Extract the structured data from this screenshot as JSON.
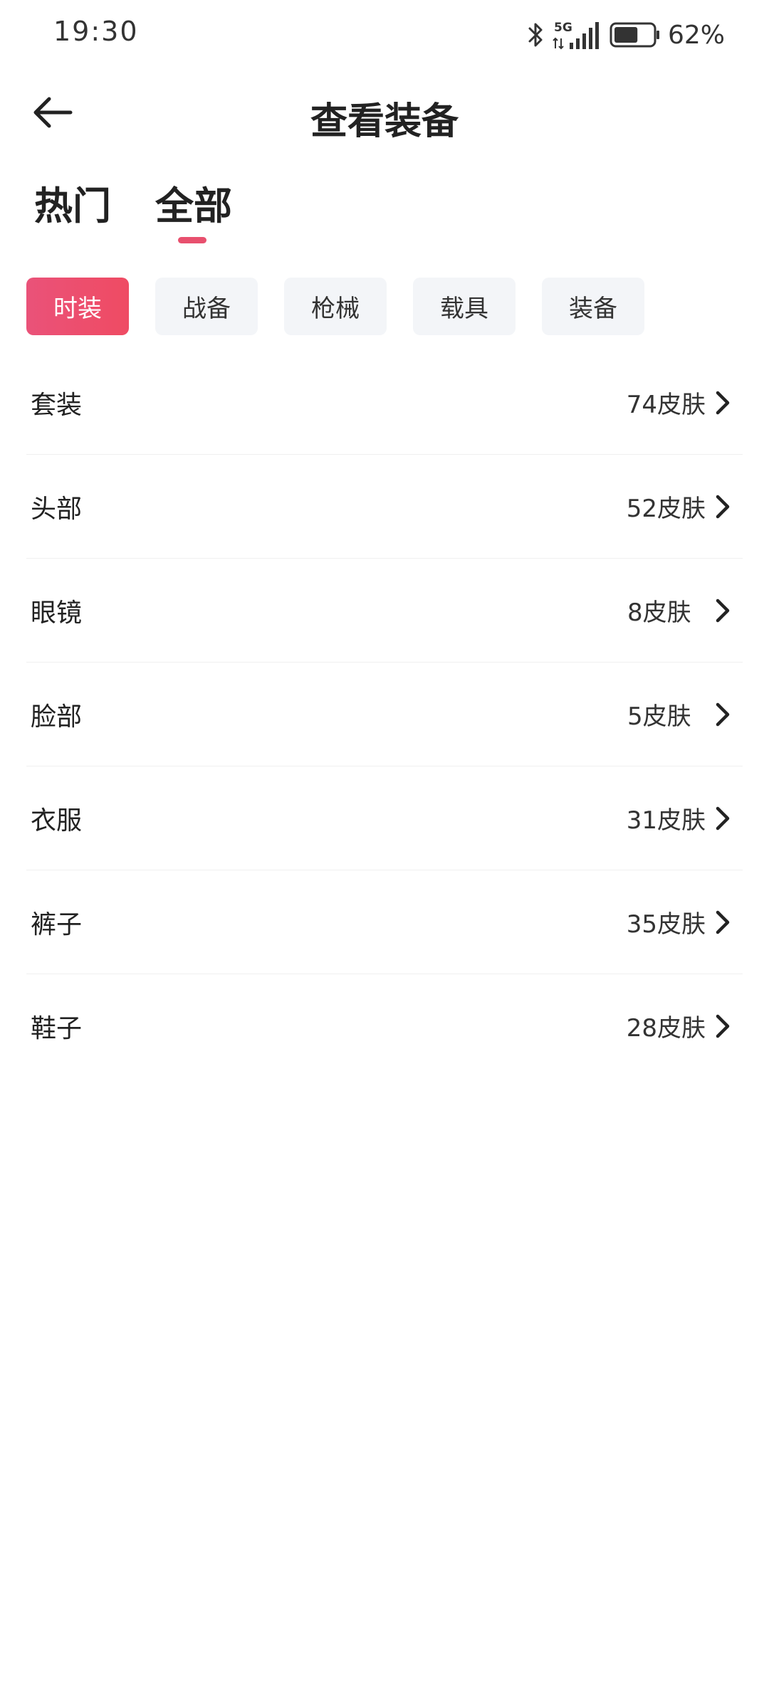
{
  "status_bar": {
    "time": "19:30",
    "network": "5G",
    "battery_percent": "62%",
    "battery_level": 0.62,
    "icons": [
      "bluetooth-icon",
      "signal-icon",
      "battery-icon"
    ]
  },
  "header": {
    "title": "查看装备",
    "back_icon": "arrow-left-icon"
  },
  "main_tabs": [
    {
      "label": "热门",
      "selected": false
    },
    {
      "label": "全部",
      "selected": true
    }
  ],
  "categories": [
    {
      "label": "时装",
      "selected": true
    },
    {
      "label": "战备",
      "selected": false
    },
    {
      "label": "枪械",
      "selected": false
    },
    {
      "label": "载具",
      "selected": false
    },
    {
      "label": "装备",
      "selected": false
    }
  ],
  "items": [
    {
      "label": "套装",
      "count": "74皮肤"
    },
    {
      "label": "头部",
      "count": "52皮肤"
    },
    {
      "label": "眼镜",
      "count": "8皮肤"
    },
    {
      "label": "脸部",
      "count": "5皮肤"
    },
    {
      "label": "衣服",
      "count": "31皮肤"
    },
    {
      "label": "裤子",
      "count": "35皮肤"
    },
    {
      "label": "鞋子",
      "count": "28皮肤"
    }
  ],
  "colors": {
    "accent": "#e8506e",
    "chip_bg": "#f3f5f8",
    "text": "#222222"
  }
}
